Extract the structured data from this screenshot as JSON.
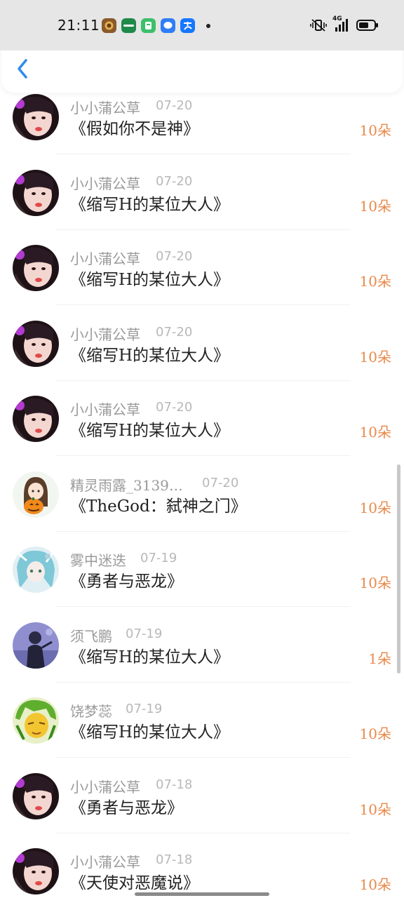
{
  "status_bar": {
    "time": "21:11",
    "network_label": "4G",
    "app_icons": [
      "game-app-icon",
      "oppo-app-icon",
      "green-app-icon",
      "blue-chat-app-icon",
      "alipay-app-icon"
    ],
    "system_icons": [
      "vibrate-icon",
      "signal-icon",
      "battery-icon"
    ]
  },
  "header": {
    "back_icon": "chevron-left-icon",
    "accent": "#2d8ce8"
  },
  "list": {
    "items": [
      {
        "user": "小小蒲公草",
        "date": "07-20",
        "title": "《假如你不是神》",
        "amount": "10朵",
        "avatar": "avatar-girl-red"
      },
      {
        "user": "小小蒲公草",
        "date": "07-20",
        "title": "《缩写H的某位大人》",
        "amount": "10朵",
        "avatar": "avatar-girl-red"
      },
      {
        "user": "小小蒲公草",
        "date": "07-20",
        "title": "《缩写H的某位大人》",
        "amount": "10朵",
        "avatar": "avatar-girl-red"
      },
      {
        "user": "小小蒲公草",
        "date": "07-20",
        "title": "《缩写H的某位大人》",
        "amount": "10朵",
        "avatar": "avatar-girl-red"
      },
      {
        "user": "小小蒲公草",
        "date": "07-20",
        "title": "《缩写H的某位大人》",
        "amount": "10朵",
        "avatar": "avatar-girl-red"
      },
      {
        "user": "精灵雨露_3139…",
        "date": "07-20",
        "title": "《TheGod：弑神之门》",
        "amount": "10朵",
        "avatar": "avatar-pumpkin-girl"
      },
      {
        "user": "雾中迷迭",
        "date": "07-19",
        "title": "《勇者与恶龙》",
        "amount": "10朵",
        "avatar": "avatar-blue-hair"
      },
      {
        "user": "须飞鹏",
        "date": "07-19",
        "title": "《缩写H的某位大人》",
        "amount": "1朵",
        "avatar": "avatar-purple-figure"
      },
      {
        "user": "饶梦蕊",
        "date": "07-19",
        "title": "《缩写H的某位大人》",
        "amount": "10朵",
        "avatar": "avatar-green-yellow"
      },
      {
        "user": "小小蒲公草",
        "date": "07-18",
        "title": "《勇者与恶龙》",
        "amount": "10朵",
        "avatar": "avatar-girl-red"
      },
      {
        "user": "小小蒲公草",
        "date": "07-18",
        "title": "《天使对恶魔说》",
        "amount": "10朵",
        "avatar": "avatar-girl-red"
      }
    ]
  },
  "colors": {
    "amount": "#e8894a",
    "name": "#9a9a9a",
    "date": "#b8b8b8",
    "title": "#222222"
  }
}
